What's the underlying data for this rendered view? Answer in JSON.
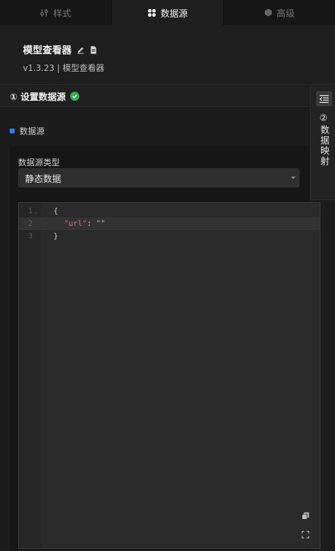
{
  "tabs": [
    {
      "label": "样式",
      "icon": "style-sliders-icon",
      "active": false
    },
    {
      "label": "数据源",
      "icon": "datasource-dots-icon",
      "active": true
    },
    {
      "label": "高级",
      "icon": "advanced-hex-icon",
      "active": false
    }
  ],
  "component": {
    "title": "模型查看器",
    "subtitle": "v1.3.23 | 模型查看器"
  },
  "step1": {
    "label": "① 设置数据源",
    "status": "complete"
  },
  "step2": {
    "label": "②数据映射"
  },
  "section": {
    "label": "数据源"
  },
  "datasource_type": {
    "label": "数据源类型",
    "selected": "静态数据"
  },
  "editor": {
    "lines": [
      {
        "number": "1",
        "text": "{"
      },
      {
        "number": "2",
        "key": "\"url\"",
        "sep": ": ",
        "value": "\"\""
      },
      {
        "number": "3",
        "text": "}"
      }
    ]
  },
  "colors": {
    "accent_blue": "#2f7cf6",
    "success_green": "#2bb34e",
    "json_key": "#e06c75",
    "json_string": "#98c379"
  }
}
